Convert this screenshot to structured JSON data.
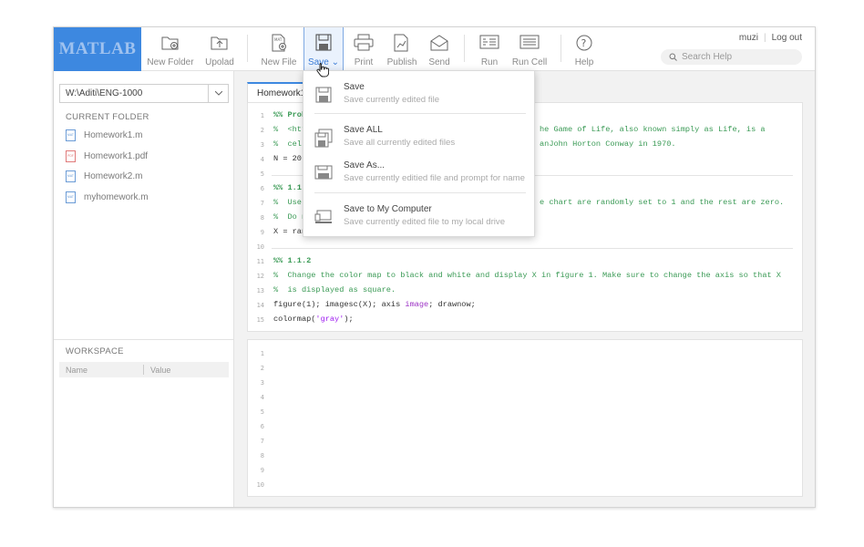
{
  "logo": "MATLAB",
  "toolbar": {
    "new_folder": "New Folder",
    "upload": "Upolad",
    "new_file": "New File",
    "save": "Save",
    "print": "Print",
    "publish": "Publish",
    "send": "Send",
    "run": "Run",
    "run_cell": "Run Cell",
    "help": "Help"
  },
  "user": {
    "name": "muzi",
    "logout": "Log out"
  },
  "search": {
    "placeholder": "Search Help"
  },
  "current_path": "W:\\Aditi\\ENG-1000",
  "current_folder_label": "CURRENT FOLDER",
  "files": [
    {
      "name": "Homework1.m",
      "type": "MAT"
    },
    {
      "name": "Homework1.pdf",
      "type": "PDF"
    },
    {
      "name": "Homework2.m",
      "type": "MAT"
    },
    {
      "name": "myhomework.m",
      "type": "MAT"
    }
  ],
  "workspace": {
    "label": "WORKSPACE",
    "col_name": "Name",
    "col_value": "Value"
  },
  "editor": {
    "tab": "Homework1",
    "lines": [
      "%% Prob",
      "%  <htt",
      "%  cell",
      "N = 20;",
      "",
      "%% 1.1",
      "%  Use",
      "%  Do n",
      "X = ran",
      "",
      "%% 1.1.2",
      "%  Change the color map to black and white and display X in figure 1. Make sure to change the axis so that X",
      "%  is displayed as square.",
      "figure(1); imagesc(X); axis image; drawnow;",
      "colormap('gray');"
    ],
    "right_fragments": {
      "l2": "he Game of Life, also known simply as Life, is a",
      "l3": "anJohn Horton Conway in 1970.",
      "l7": "e chart are randomly set to 1 and the rest are zero."
    }
  },
  "command_lines": [
    "1",
    "2",
    "3",
    "4",
    "5",
    "6",
    "7",
    "8",
    "9",
    "10"
  ],
  "save_menu": [
    {
      "title": "Save",
      "desc": "Save currently edited file"
    },
    {
      "title": "Save ALL",
      "desc": "Save all currently edited files"
    },
    {
      "title": "Save As...",
      "desc": "Save currently editied file and prompt for name"
    },
    {
      "title": "Save to My Computer",
      "desc": "Save currently edited file to my local drive"
    }
  ],
  "colors": {
    "accent": "#3d88e0",
    "comment": "#3a9a55",
    "string": "#a020f0"
  }
}
